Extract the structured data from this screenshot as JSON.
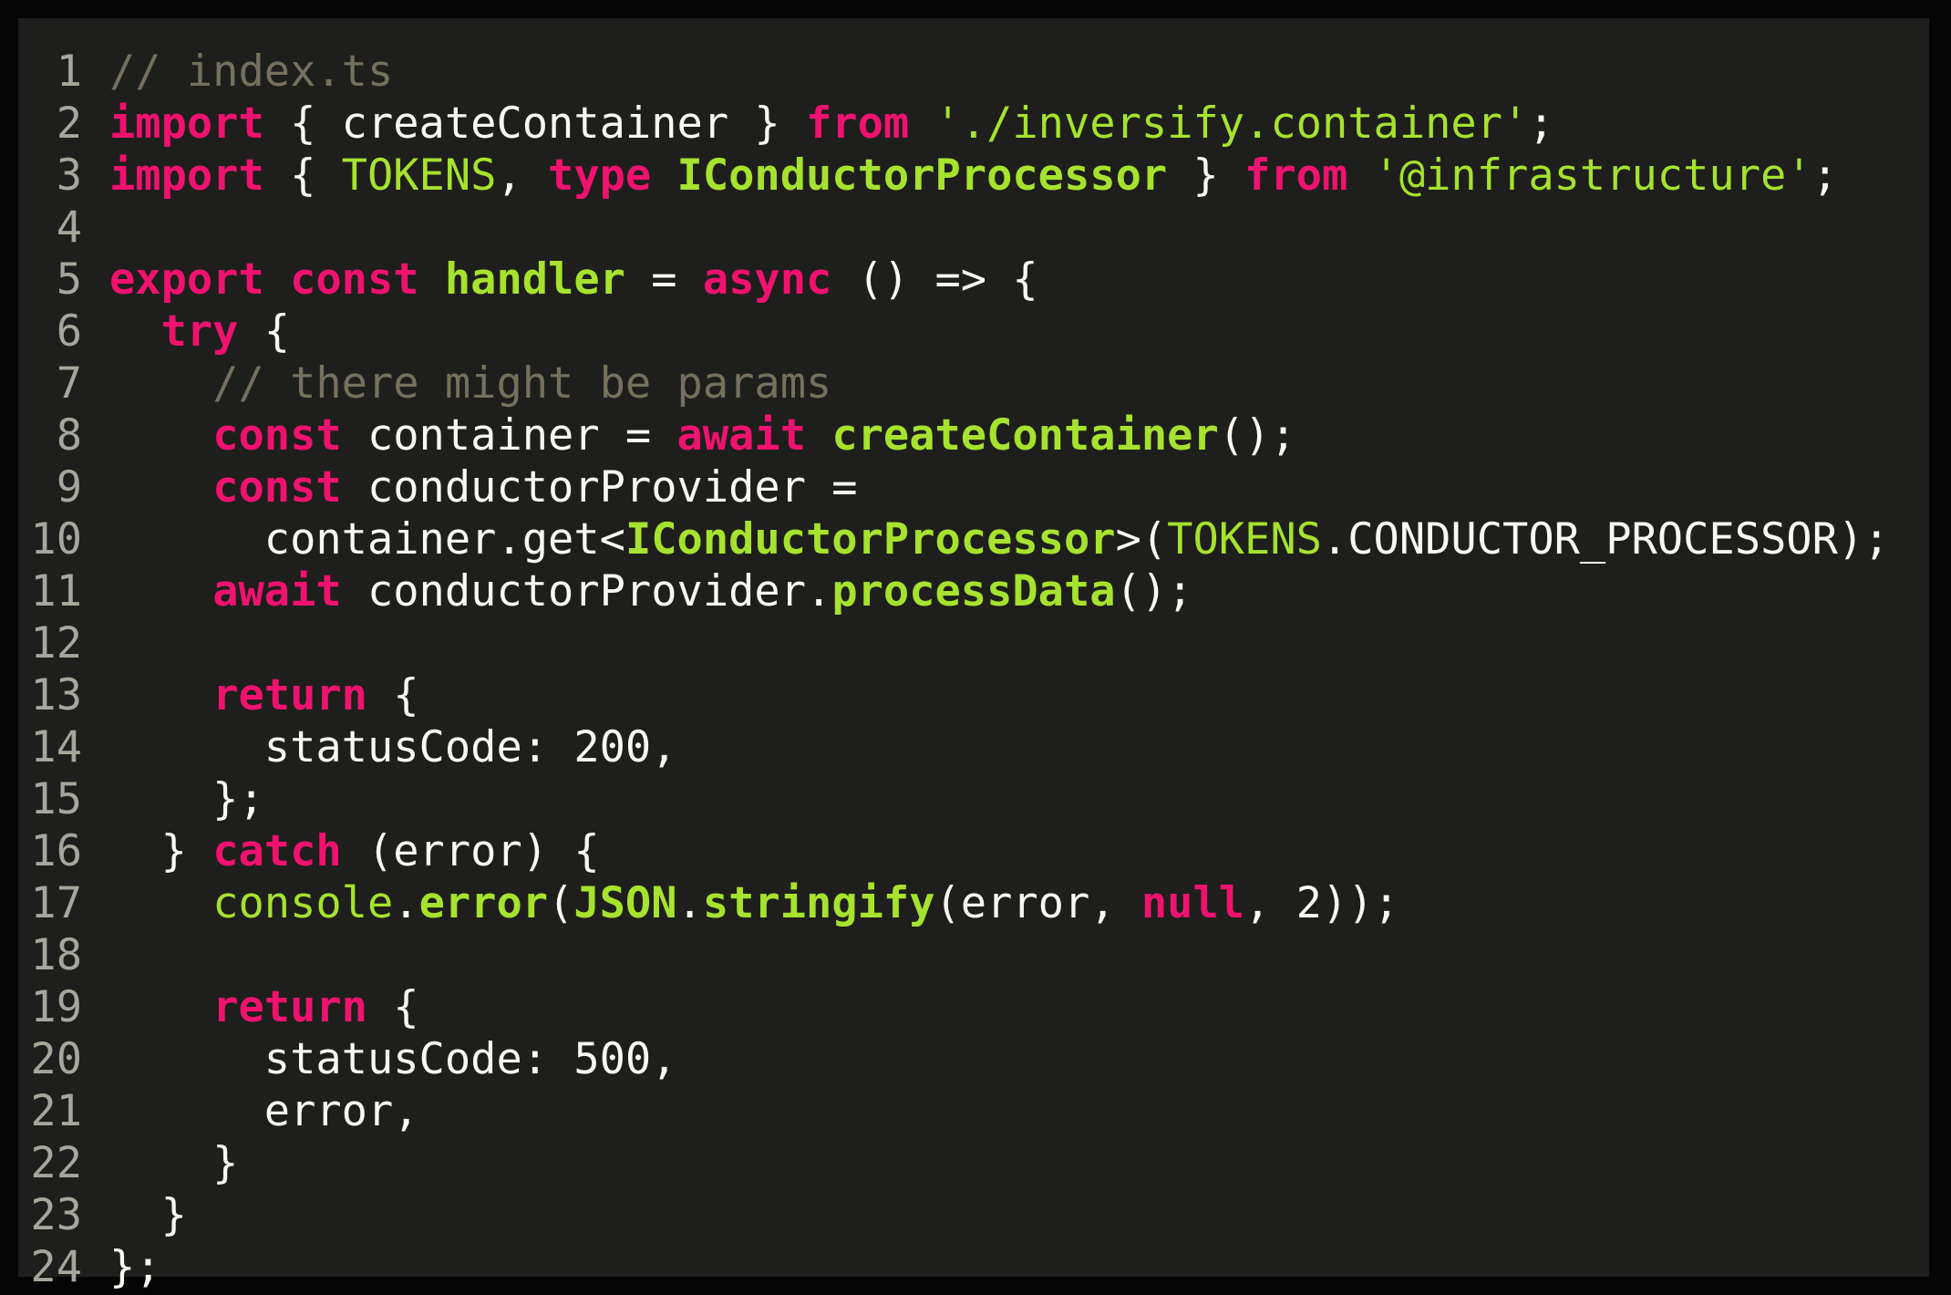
{
  "window": {
    "background": "#050505",
    "editor_background": "#1e1f1c"
  },
  "colors": {
    "keyword": "#f0126f",
    "function": "#a6e22e",
    "string": "#a6e22e",
    "comment": "#75715e",
    "text": "#f8f8f2",
    "line_number": "#a6a69c"
  },
  "editor": {
    "language": "typescript",
    "lines": [
      {
        "n": "1",
        "tokens": [
          {
            "t": "// index.ts",
            "c": "cm"
          }
        ]
      },
      {
        "n": "2",
        "tokens": [
          {
            "t": "import",
            "c": "kw"
          },
          {
            "t": " { createContainer } ",
            "c": "pl"
          },
          {
            "t": "from",
            "c": "kw"
          },
          {
            "t": " ",
            "c": "pl"
          },
          {
            "t": "'./inversify.container'",
            "c": "str"
          },
          {
            "t": ";",
            "c": "pl"
          }
        ]
      },
      {
        "n": "3",
        "tokens": [
          {
            "t": "import",
            "c": "kw"
          },
          {
            "t": " { ",
            "c": "pl"
          },
          {
            "t": "TOKENS",
            "c": "ty"
          },
          {
            "t": ", ",
            "c": "pl"
          },
          {
            "t": "type",
            "c": "kw"
          },
          {
            "t": " ",
            "c": "pl"
          },
          {
            "t": "IConductorProcessor",
            "c": "fn"
          },
          {
            "t": " } ",
            "c": "pl"
          },
          {
            "t": "from",
            "c": "kw"
          },
          {
            "t": " ",
            "c": "pl"
          },
          {
            "t": "'@infrastructure'",
            "c": "str"
          },
          {
            "t": ";",
            "c": "pl"
          }
        ]
      },
      {
        "n": "4",
        "tokens": []
      },
      {
        "n": "5",
        "tokens": [
          {
            "t": "export",
            "c": "kw"
          },
          {
            "t": " ",
            "c": "pl"
          },
          {
            "t": "const",
            "c": "kw"
          },
          {
            "t": " ",
            "c": "pl"
          },
          {
            "t": "handler",
            "c": "fn"
          },
          {
            "t": " = ",
            "c": "pl"
          },
          {
            "t": "async",
            "c": "kw"
          },
          {
            "t": " () => {",
            "c": "pl"
          }
        ]
      },
      {
        "n": "6",
        "tokens": [
          {
            "t": "  ",
            "c": "pl"
          },
          {
            "t": "try",
            "c": "kw"
          },
          {
            "t": " {",
            "c": "pl"
          }
        ]
      },
      {
        "n": "7",
        "tokens": [
          {
            "t": "    ",
            "c": "pl"
          },
          {
            "t": "// there might be params",
            "c": "cm"
          }
        ]
      },
      {
        "n": "8",
        "tokens": [
          {
            "t": "    ",
            "c": "pl"
          },
          {
            "t": "const",
            "c": "kw"
          },
          {
            "t": " container = ",
            "c": "pl"
          },
          {
            "t": "await",
            "c": "kw"
          },
          {
            "t": " ",
            "c": "pl"
          },
          {
            "t": "createContainer",
            "c": "fn"
          },
          {
            "t": "();",
            "c": "pl"
          }
        ]
      },
      {
        "n": "9",
        "tokens": [
          {
            "t": "    ",
            "c": "pl"
          },
          {
            "t": "const",
            "c": "kw"
          },
          {
            "t": " conductorProvider =",
            "c": "pl"
          }
        ]
      },
      {
        "n": "10",
        "tokens": [
          {
            "t": "      container.get<",
            "c": "pl"
          },
          {
            "t": "IConductorProcessor",
            "c": "fn"
          },
          {
            "t": ">(",
            "c": "pl"
          },
          {
            "t": "TOKENS",
            "c": "ty"
          },
          {
            "t": ".CONDUCTOR_PROCESSOR);",
            "c": "pl"
          }
        ]
      },
      {
        "n": "11",
        "tokens": [
          {
            "t": "    ",
            "c": "pl"
          },
          {
            "t": "await",
            "c": "kw"
          },
          {
            "t": " conductorProvider.",
            "c": "pl"
          },
          {
            "t": "processData",
            "c": "fn"
          },
          {
            "t": "();",
            "c": "pl"
          }
        ]
      },
      {
        "n": "12",
        "tokens": []
      },
      {
        "n": "13",
        "tokens": [
          {
            "t": "    ",
            "c": "pl"
          },
          {
            "t": "return",
            "c": "kw"
          },
          {
            "t": " {",
            "c": "pl"
          }
        ]
      },
      {
        "n": "14",
        "tokens": [
          {
            "t": "      statusCode: 200,",
            "c": "pl"
          }
        ]
      },
      {
        "n": "15",
        "tokens": [
          {
            "t": "    };",
            "c": "pl"
          }
        ]
      },
      {
        "n": "16",
        "tokens": [
          {
            "t": "  } ",
            "c": "pl"
          },
          {
            "t": "catch",
            "c": "kw"
          },
          {
            "t": " (error) {",
            "c": "pl"
          }
        ]
      },
      {
        "n": "17",
        "tokens": [
          {
            "t": "    ",
            "c": "pl"
          },
          {
            "t": "console",
            "c": "ty"
          },
          {
            "t": ".",
            "c": "pl"
          },
          {
            "t": "error",
            "c": "fn"
          },
          {
            "t": "(",
            "c": "pl"
          },
          {
            "t": "JSON",
            "c": "fn"
          },
          {
            "t": ".",
            "c": "pl"
          },
          {
            "t": "stringify",
            "c": "fn"
          },
          {
            "t": "(error, ",
            "c": "pl"
          },
          {
            "t": "null",
            "c": "kw"
          },
          {
            "t": ", 2));",
            "c": "pl"
          }
        ]
      },
      {
        "n": "18",
        "tokens": []
      },
      {
        "n": "19",
        "tokens": [
          {
            "t": "    ",
            "c": "pl"
          },
          {
            "t": "return",
            "c": "kw"
          },
          {
            "t": " {",
            "c": "pl"
          }
        ]
      },
      {
        "n": "20",
        "tokens": [
          {
            "t": "      statusCode: 500,",
            "c": "pl"
          }
        ]
      },
      {
        "n": "21",
        "tokens": [
          {
            "t": "      error,",
            "c": "pl"
          }
        ]
      },
      {
        "n": "22",
        "tokens": [
          {
            "t": "    }",
            "c": "pl"
          }
        ]
      },
      {
        "n": "23",
        "tokens": [
          {
            "t": "  }",
            "c": "pl"
          }
        ]
      },
      {
        "n": "24",
        "tokens": [
          {
            "t": "};",
            "c": "pl"
          }
        ]
      }
    ]
  }
}
